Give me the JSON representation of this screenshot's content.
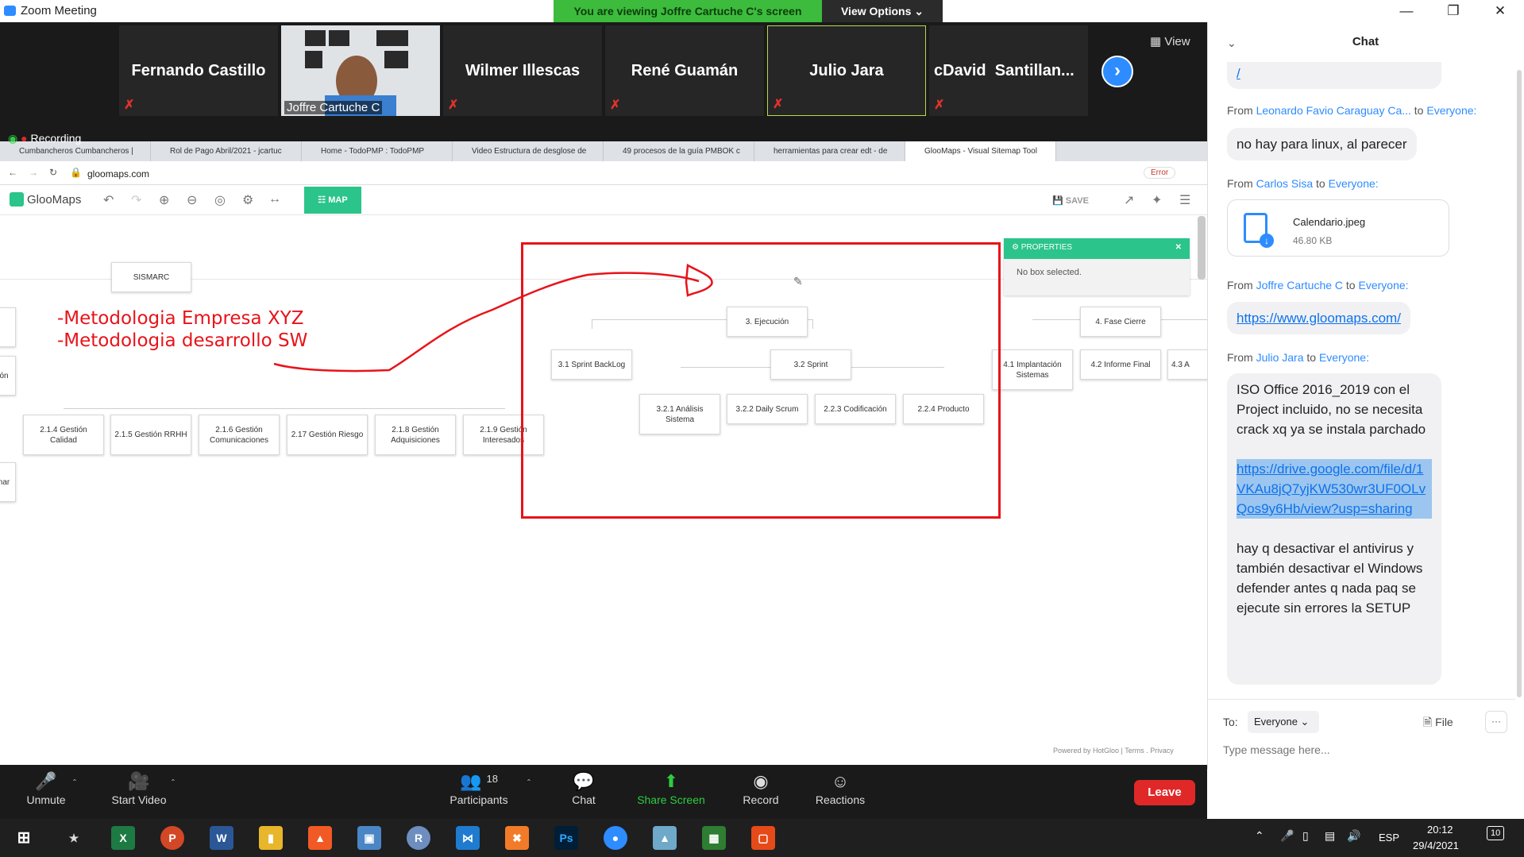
{
  "window": {
    "title": "Zoom Meeting",
    "viewing_banner": "You are viewing Joffre Cartuche C's screen",
    "view_options": "View Options"
  },
  "gallery": {
    "participants": [
      "Fernando Castillo",
      "Joffre Cartuche C",
      "Wilmer Illescas",
      "René Guamán",
      "Julio Jara",
      "cDavid  Santillan..."
    ],
    "view_label": "View",
    "recording": "Recording"
  },
  "browser": {
    "tabs": [
      "Cumbancheros Cumbancheros |",
      "Rol de Pago Abril/2021 - jcartuc",
      "Home - TodoPMP : TodoPMP",
      "Video Estructura de desglose de",
      "49 procesos de la guía PMBOK c",
      "herramientas para crear edt - de",
      "GlooMaps - Visual Sitemap Tool"
    ],
    "url": "gloomaps.com",
    "error_label": "Error"
  },
  "gloomaps": {
    "logo": "GlooMaps",
    "map_button": "MAP",
    "save_button": "SAVE",
    "properties_title": "PROPERTIES",
    "properties_body": "No box selected.",
    "footer": "Powered by HotGloo | Terms . Privacy",
    "nodes": {
      "sismarc": "SISMARC",
      "n214": "2.1.4 Gestión Calidad",
      "n215": "2.1.5 Gestión RRHH",
      "n216": "2.1.6 Gestión Comunicaciones",
      "n217": "2.17 Gestión Riesgo",
      "n218": "2.1.8 Gestión Adquisiciones",
      "n219": "2.1.9 Gestión Interesados",
      "n3": "3. Ejecución",
      "n31": "3.1  Sprint BackLog",
      "n32": "3.2 Sprint",
      "n321": "3.2.1 Análisis Sistema",
      "n322": "3.2.2 Daily Scrum",
      "n323": "2.2.3 Codificación",
      "n324": "2.2.4 Producto",
      "n4": "4. Fase Cierre",
      "n41": "4.1 Implantación Sistemas",
      "n42": "4.2 Informe Final",
      "n43": "4.3 A",
      "left1": "ón",
      "left2": "nar"
    },
    "annotation": [
      "-Metodologia Empresa XYZ",
      "-Metodologia desarrollo SW"
    ]
  },
  "chat": {
    "title": "Chat",
    "top_link": "/",
    "messages": [
      {
        "from": "From",
        "name": "Leonardo Favio Caraguay Ca...",
        "to": "to",
        "target": "Everyone:",
        "text": "no hay para linux, al parecer"
      },
      {
        "from": "From",
        "name": "Carlos Sisa",
        "to": "to",
        "target": "Everyone:",
        "file": "Calendario.jpeg",
        "size": "46.80 KB"
      },
      {
        "from": "From",
        "name": "Joffre Cartuche C",
        "to": "to",
        "target": "Everyone:",
        "link": "https://www.gloomaps.com/"
      },
      {
        "from": "From",
        "name": "Julio Jara",
        "to": "to",
        "target": "Everyone:",
        "text": "ISO Office 2016_2019 con el Project incluido, no se necesita crack xq ya se instala parchado",
        "link": "https://drive.google.com/file/d/1VKAu8jQ7yjKW530wr3UF0OLvQos9y6Hb/view?usp=sharing",
        "text2": "hay q desactivar el antivirus y también desactivar el Windows defender antes q nada paq se ejecute sin errores la SETUP"
      }
    ],
    "to_label": "To:",
    "to_value": "Everyone",
    "file_label": "File",
    "more": "···",
    "placeholder": "Type message here..."
  },
  "controls": {
    "unmute": "Unmute",
    "start_video": "Start Video",
    "participants": "Participants",
    "participants_count": "18",
    "chat": "Chat",
    "share_screen": "Share Screen",
    "record": "Record",
    "reactions": "Reactions",
    "leave": "Leave"
  },
  "taskbar": {
    "language": "ESP",
    "time": "20:12",
    "date": "29/4/2021",
    "notifications": "10"
  },
  "colors": {
    "zoom_blue": "#2d8cff",
    "banner_green": "#3dbb3d",
    "gloo_green": "#2bc48a",
    "annotation_red": "#e8131a",
    "leave_red": "#e02828"
  }
}
